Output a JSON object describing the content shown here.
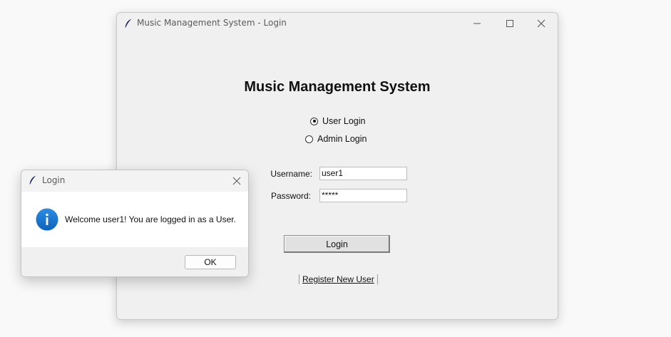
{
  "main_window": {
    "title": "Music Management System - Login",
    "heading": "Music Management System",
    "login_type": {
      "user_label": "User Login",
      "admin_label": "Admin Login",
      "selected": "User Login"
    },
    "username": {
      "label": "Username:",
      "value": "user1"
    },
    "password": {
      "label": "Password:",
      "value": "*****"
    },
    "login_label": "Login",
    "register_label": "Register New User"
  },
  "dialog": {
    "title": "Login",
    "icon": "info-icon",
    "message": "Welcome user1! You are logged in as a User.",
    "ok_label": "OK"
  },
  "colors": {
    "window_bg": "#f0f0f0",
    "info_icon": "#1a78d4"
  }
}
